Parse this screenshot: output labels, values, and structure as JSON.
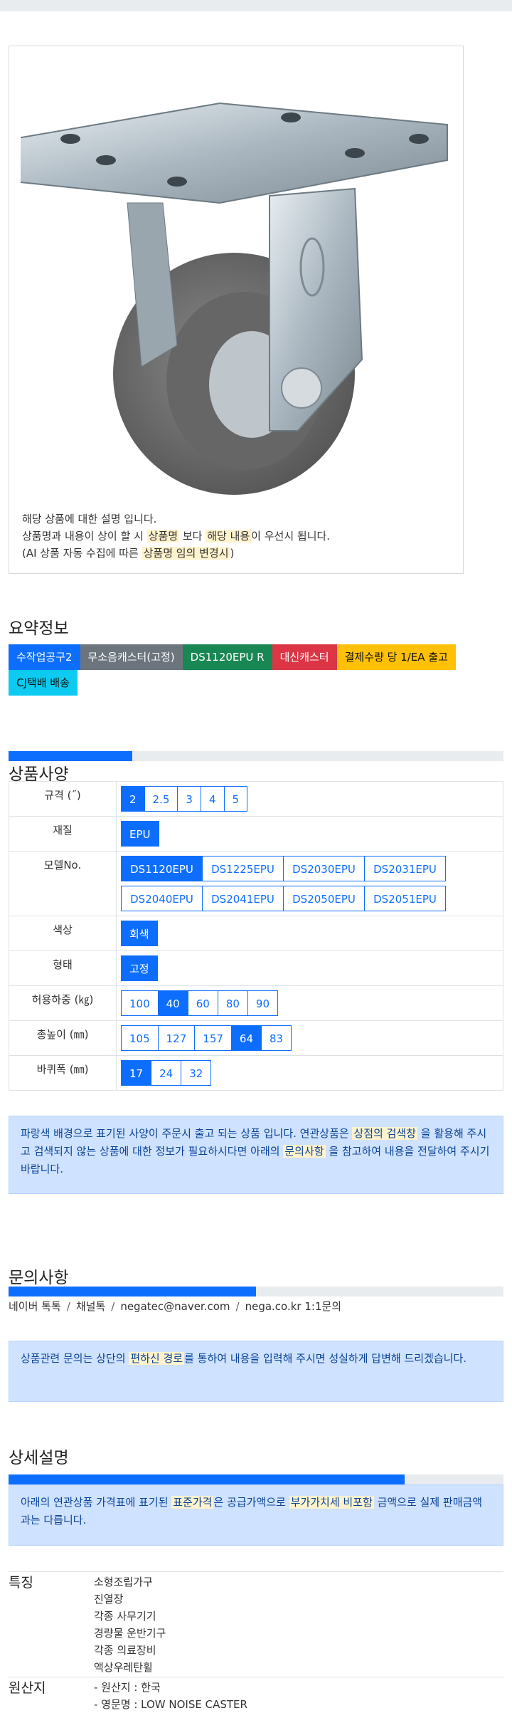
{
  "image_caption": {
    "line1": "해당 상품에 대한 설명 입니다.",
    "line2_pre": "상품명과 내용이 상이 할 시 ",
    "line2_hl1": "상품명",
    "line2_mid": " 보다 ",
    "line2_hl2": "해당 내용",
    "line2_post": "이 우선시 됩니다.",
    "line3_pre": "(AI 상품 자동 수집에 따른 ",
    "line3_hl": "상품명 임의 변경시",
    "line3_post": ")"
  },
  "summary": {
    "title": "요약정보",
    "tags": [
      "수작업공구2",
      "무소음캐스터(고정)",
      "DS1120EPU R",
      "대신캐스터",
      "결제수량 당 1/EA 출고",
      "CJ택배 배송"
    ],
    "tag_colors": [
      "#0d6efd",
      "#6c757d",
      "#198754",
      "#dc3545",
      "#ffc107",
      "#0dcaf0"
    ]
  },
  "specs": {
    "title": "상품사양",
    "progress_fraction": 0.25,
    "rows": [
      {
        "label": "규격 (˝)",
        "options": [
          "2",
          "2.5",
          "3",
          "4",
          "5"
        ],
        "selected": [
          "2"
        ]
      },
      {
        "label": "재질",
        "options": [
          "EPU"
        ],
        "selected": [
          "EPU"
        ]
      },
      {
        "label": "모델No.",
        "options": [
          "DS1120EPU",
          "DS1225EPU",
          "DS2030EPU",
          "DS2031EPU",
          "DS2040EPU",
          "DS2041EPU",
          "DS2050EPU",
          "DS2051EPU"
        ],
        "selected": [
          "DS1120EPU"
        ]
      },
      {
        "label": "색상",
        "options": [
          "회색"
        ],
        "selected": [
          "회색"
        ]
      },
      {
        "label": "형태",
        "options": [
          "고정"
        ],
        "selected": [
          "고정"
        ]
      },
      {
        "label": "허용하중 (㎏)",
        "options": [
          "100",
          "40",
          "60",
          "80",
          "90"
        ],
        "selected": [
          "40"
        ]
      },
      {
        "label": "총높이 (㎜)",
        "options": [
          "105",
          "127",
          "157",
          "64",
          "83"
        ],
        "selected": [
          "64"
        ]
      },
      {
        "label": "바퀴폭 (㎜)",
        "options": [
          "17",
          "24",
          "32"
        ],
        "selected": [
          "17"
        ]
      }
    ],
    "notice_pre": "파랑색 배경으로 표기된 사양이 주문시 출고 되는 상품 입니다. 연관상품은 ",
    "notice_hl1": "상점의 검색창",
    "notice_mid": " 을 활용해 주시고 검색되지 않는 상품에 대한 정보가 필요하시다면 아래의 ",
    "notice_hl2": "문의사항",
    "notice_post": " 을 참고하여 내용을 전달하여 주시기 바랍니다."
  },
  "inquiry": {
    "title": "문의사항",
    "progress_fraction": 0.5,
    "channels": [
      "네이버 톡톡",
      "채널톡",
      "negatec@naver.com",
      "nega.co.kr 1:1문의"
    ],
    "separator": "/",
    "notice_pre": "상품관련 문의는 상단의 ",
    "notice_hl": "편하신 경로",
    "notice_post": "를 통하여 내용을 입력해 주시면 성실하게 답변해 드리겠습니다."
  },
  "detail": {
    "title": "상세설명",
    "progress_fraction": 0.8,
    "notice_pre": "아래의 연관상품 가격표에 표기된 ",
    "notice_hl1": "표준가격",
    "notice_mid": "은 공급가액으로 ",
    "notice_hl2": "부가가치세 비포함",
    "notice_post": " 금액으로 실제 판매금액과는 다릅니다."
  },
  "features": {
    "label": "특징",
    "items": [
      "소형조립가구",
      "진열장",
      "각종 사무기기",
      "경량물 운반기구",
      "각종 의료장비",
      "액상우레탄휠"
    ]
  },
  "origin": {
    "label": "원산지",
    "items": [
      "- 원산지 : 한국",
      "- 영문명 : LOW NOISE CASTER"
    ]
  }
}
